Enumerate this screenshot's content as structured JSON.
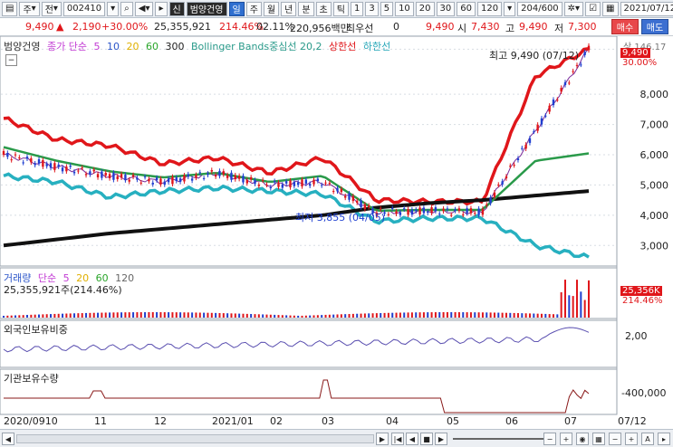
{
  "toolbar": {
    "mode_label": "주",
    "jeon_label": "전",
    "code_value": "002410",
    "credit_badge": "신",
    "stock_name": "범양건영",
    "periods": [
      "일",
      "주",
      "월",
      "년",
      "분",
      "초",
      "틱"
    ],
    "active_period": "일",
    "intervals": [
      "1",
      "3",
      "5",
      "10",
      "20",
      "30",
      "60",
      "120"
    ],
    "count_value": "204/600",
    "date_value": "2021/07/12"
  },
  "quote": {
    "price": "9,490",
    "change": "2,190",
    "change_pct": "+30.00%",
    "volume": "25,355,921",
    "turnover_pct": "214.46%",
    "rate": "02.11%",
    "amount": "220,956백만",
    "best_label": "최우선",
    "best_value": "0",
    "price2": "9,490",
    "open_label": "시",
    "open_value": "7,430",
    "high_label": "고",
    "high_value": "9,490",
    "low_label": "저",
    "low_value": "7,300",
    "buy_label": "매수",
    "sell_label": "매도"
  },
  "price_panel": {
    "legend_name": "범양건영",
    "legend_ma": "종가 단순",
    "ma_periods": [
      "5",
      "10",
      "20",
      "60",
      "300"
    ],
    "legend_bb": "Bollinger Bands중심선 20,2",
    "legend_upper": "상한선",
    "legend_lower": "하한선",
    "high_note": "최고 9,490 (07/12)",
    "low_note": "최저 3,855 (04/05)",
    "last_price_box": "9,490",
    "last_pct_box": "30.00%",
    "upper_cap": "상 146.17"
  },
  "volume_panel": {
    "legend_name": "거래량",
    "legend_ma": "단순",
    "ma_periods": [
      "5",
      "20",
      "60",
      "120"
    ],
    "volume_note": "25,355,921주(214.46%)",
    "box_value": "25,356K",
    "box_pct": "214.46%"
  },
  "foreign_panel": {
    "legend_name": "외국인보유비중",
    "axis_value": "2,00"
  },
  "inst_panel": {
    "legend_name": "기관보유수량",
    "axis_value": "-400,000"
  },
  "time_axis": [
    "2020/0910",
    "11",
    "12",
    "2021/01",
    "02",
    "03",
    "04",
    "05",
    "06",
    "07",
    "07/12"
  ],
  "chart_data": {
    "type": "line",
    "x": [
      "2020/09",
      "2020/10",
      "2020/11",
      "2020/12",
      "2021/01",
      "2021/02",
      "2021/03",
      "2021/04",
      "2021/05",
      "2021/06",
      "2021/07",
      "2021/07/12"
    ],
    "series": [
      {
        "name": "종가",
        "values": [
          6000,
          5600,
          5300,
          5100,
          5400,
          5000,
          5100,
          4100,
          4150,
          4100,
          6800,
          9490
        ]
      },
      {
        "name": "상한선",
        "values": [
          7200,
          6500,
          6300,
          5700,
          5900,
          5400,
          5900,
          4500,
          4450,
          4450,
          8600,
          9490
        ]
      },
      {
        "name": "하한선",
        "values": [
          5300,
          5100,
          4600,
          4800,
          4900,
          4800,
          4700,
          3800,
          3900,
          3900,
          3000,
          2600
        ]
      },
      {
        "name": "300",
        "values": [
          3000,
          3200,
          3400,
          3550,
          3700,
          3850,
          4000,
          4250,
          4400,
          4500,
          4650,
          4800
        ]
      }
    ],
    "ylim": [
      2500,
      9500
    ],
    "yticks": [
      "9,490",
      "8,000",
      "7,000",
      "6,000",
      "5,000",
      "4,000",
      "3,000"
    ]
  }
}
